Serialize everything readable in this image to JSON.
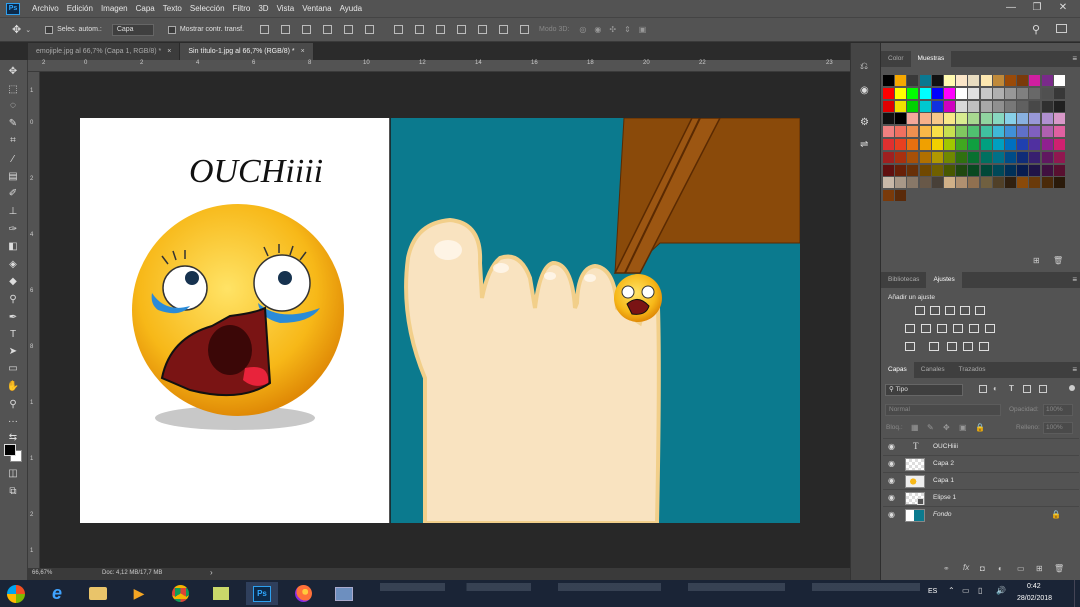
{
  "menu": [
    "Archivo",
    "Edición",
    "Imagen",
    "Capa",
    "Texto",
    "Selección",
    "Filtro",
    "3D",
    "Vista",
    "Ventana",
    "Ayuda"
  ],
  "app_logo": "Ps",
  "options": {
    "auto_select_label": "Selec. autom.:",
    "auto_select_value": "Capa",
    "show_transform_label": "Mostrar contr. transf.",
    "mode_3d_label": "Modo 3D:"
  },
  "tabs": [
    {
      "label": "emojiple.jpg al 66,7% (Capa 1, RGB/8) *",
      "close": "×"
    },
    {
      "label": "Sin título-1.jpg al 66,7% (RGB/8) *",
      "close": "×"
    }
  ],
  "ruler_h": [
    "2",
    "0",
    "2",
    "4",
    "6",
    "8",
    "10",
    "12",
    "14",
    "16",
    "18",
    "20",
    "22",
    "23"
  ],
  "ruler_v": [
    "1",
    "0",
    "2",
    "4",
    "6",
    "8",
    "1",
    "1",
    "2",
    "1"
  ],
  "canvas": {
    "ouch_text": "OUCHiiii",
    "colors": {
      "teal": "#0b7a8e",
      "skin": "#f9e3c0",
      "skin_outline": "#f2cf8a",
      "wood": "#8a4a0a",
      "emoji_yellow": "#f7b818"
    }
  },
  "status": {
    "zoom": "66,67%",
    "doc": "Doc: 4,12 MB/17,7 MB"
  },
  "color_panel": {
    "tab1": "Color",
    "tab2": "Muestras"
  },
  "adjust_panel": {
    "tab1": "Bibliotecas",
    "tab2": "Ajustes",
    "title": "Añadir un ajuste"
  },
  "layers_panel": {
    "tab1": "Capas",
    "tab2": "Canales",
    "tab3": "Trazados",
    "filter_label": "Tipo",
    "blend_mode": "Normal",
    "opacity_label": "Opacidad:",
    "opacity_value": "100%",
    "lock_label": "Bloq.:",
    "fill_label": "Relleno:",
    "fill_value": "100%",
    "layers": [
      {
        "name": "OUCHiiii",
        "kind": "text"
      },
      {
        "name": "Capa 2",
        "kind": "layer"
      },
      {
        "name": "Capa 1",
        "kind": "layer"
      },
      {
        "name": "Elipse 1",
        "kind": "shape"
      },
      {
        "name": "Fondo",
        "kind": "background"
      }
    ]
  },
  "taskbar": {
    "lang": "ES",
    "time": "0:42",
    "date": "28/02/2018"
  }
}
